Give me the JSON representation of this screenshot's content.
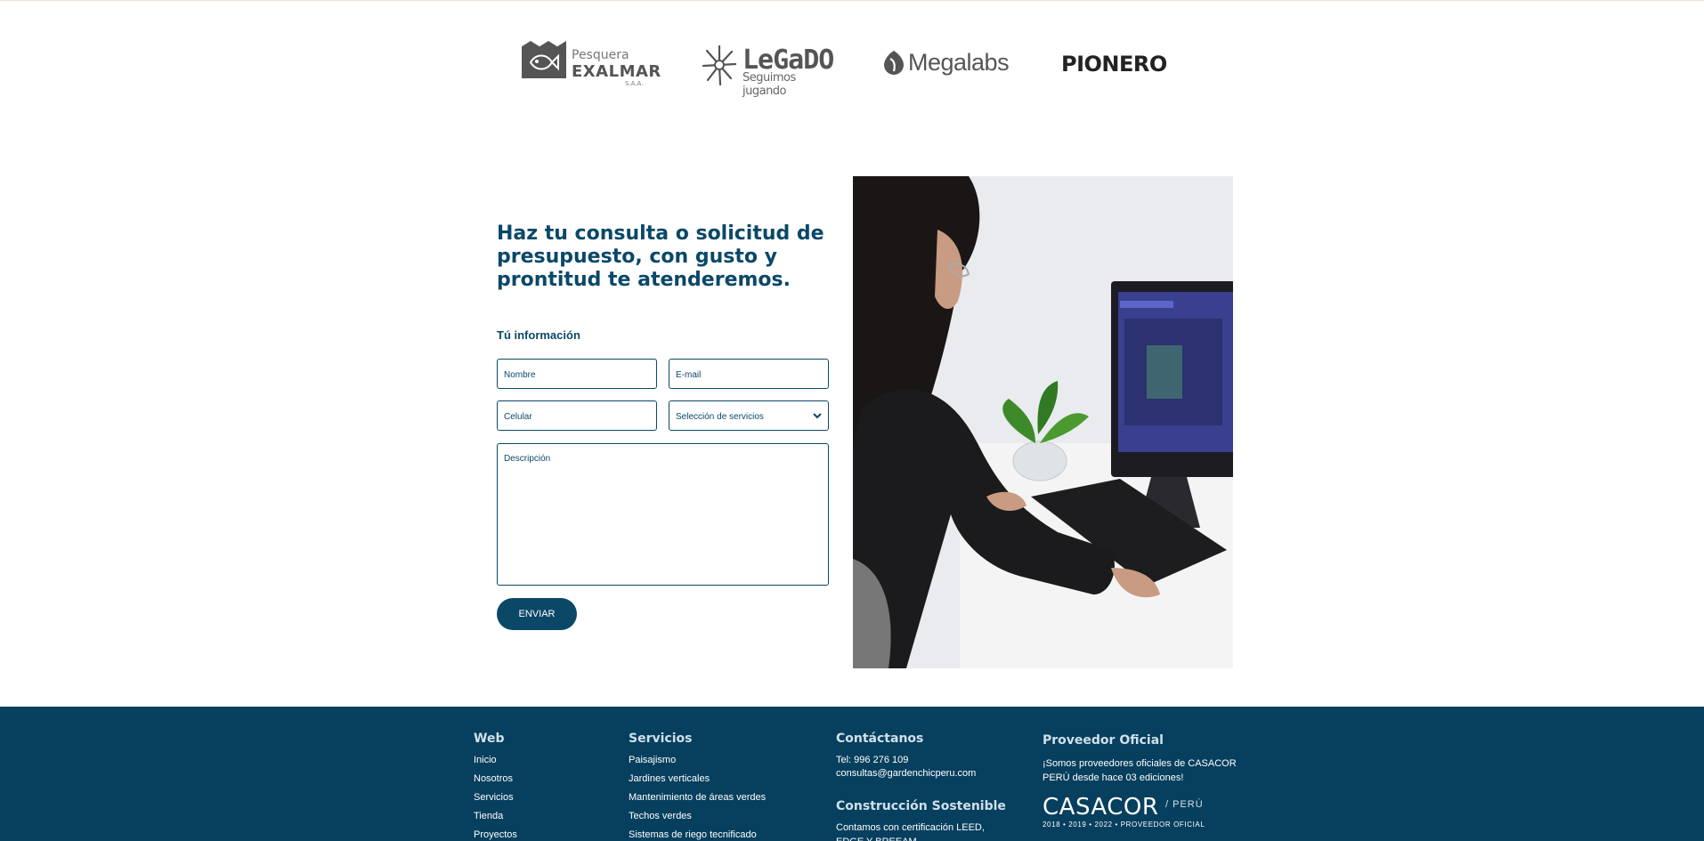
{
  "logos": {
    "exalmar": {
      "top": "Pesquera",
      "main": "EXALMAR",
      "sub": "S.A.A."
    },
    "legado": {
      "main": "LeGaDO",
      "sub": "Seguimos jugando"
    },
    "megalabs": {
      "name": "Megalabs"
    },
    "pionero": {
      "name": "PIONERO"
    }
  },
  "contact": {
    "heading": "Haz tu consulta o solicitud de presupuesto, con gusto y prontitud te atenderemos.",
    "subtitle": "Tú información",
    "fields": {
      "nombre_placeholder": "Nombre",
      "email_placeholder": "E-mail",
      "celular_placeholder": "Celular",
      "servicios_selected": "Selección de servicios",
      "descripcion_placeholder": "Descripción"
    },
    "send_label": "ENVIAR"
  },
  "footer": {
    "web": {
      "title": "Web",
      "links": [
        "Inicio",
        "Nosotros",
        "Servicios",
        "Tienda",
        "Proyectos"
      ]
    },
    "servicios": {
      "title": "Servicios",
      "links": [
        "Paisajismo",
        "Jardines verticales",
        "Mantenimiento de áreas verdes",
        "Techos verdes",
        "Sistemas de riego tecnificado"
      ]
    },
    "contacto": {
      "title": "Contáctanos",
      "phone": "Tel: 996 276 109",
      "email": "consultas@gardenchicperu.com",
      "sostenible_title": "Construcción Sostenible",
      "sostenible_text": "Contamos con certificación LEED, EDGE Y BREEAM"
    },
    "proveedor": {
      "title": "Proveedor Oficial",
      "text": "¡Somos proveedores oficiales de CASACOR PERÚ desde hace 03 ediciones!",
      "casacor": "CASACOR",
      "casacor_country": "/ PERÚ",
      "casacor_years": "2018 • 2019 • 2022 • PROVEEDOR OFICIAL"
    }
  },
  "colors": {
    "brand": "#0b4868",
    "footer_bg": "#073f5e"
  }
}
